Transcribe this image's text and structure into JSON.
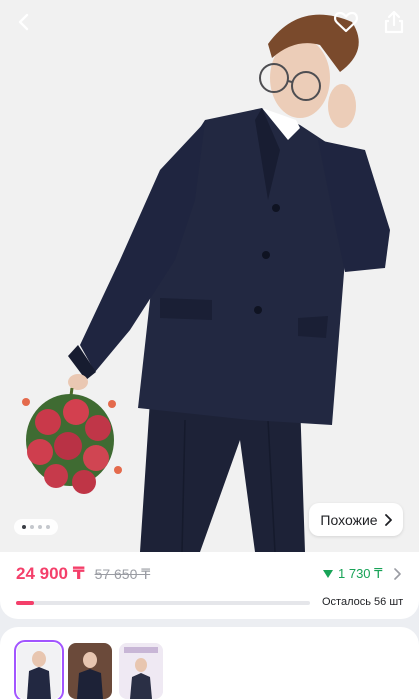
{
  "header": {
    "back_icon": "chevron-left-icon",
    "favorite_icon": "heart-icon",
    "share_icon": "share-icon"
  },
  "gallery": {
    "image_count": 4,
    "active_index": 0,
    "similar_label": "Похожие"
  },
  "price": {
    "current": "24 900 ₸",
    "old": "57 650 ₸",
    "bonus": "1 730 ₸",
    "bonus_color": "#18a357",
    "accent_color": "#f43f6a"
  },
  "stock": {
    "label": "Осталось 56 шт",
    "progress_fraction": 0.06
  },
  "thumbnails": [
    {
      "selected": true
    },
    {
      "selected": false
    },
    {
      "selected": false
    }
  ]
}
